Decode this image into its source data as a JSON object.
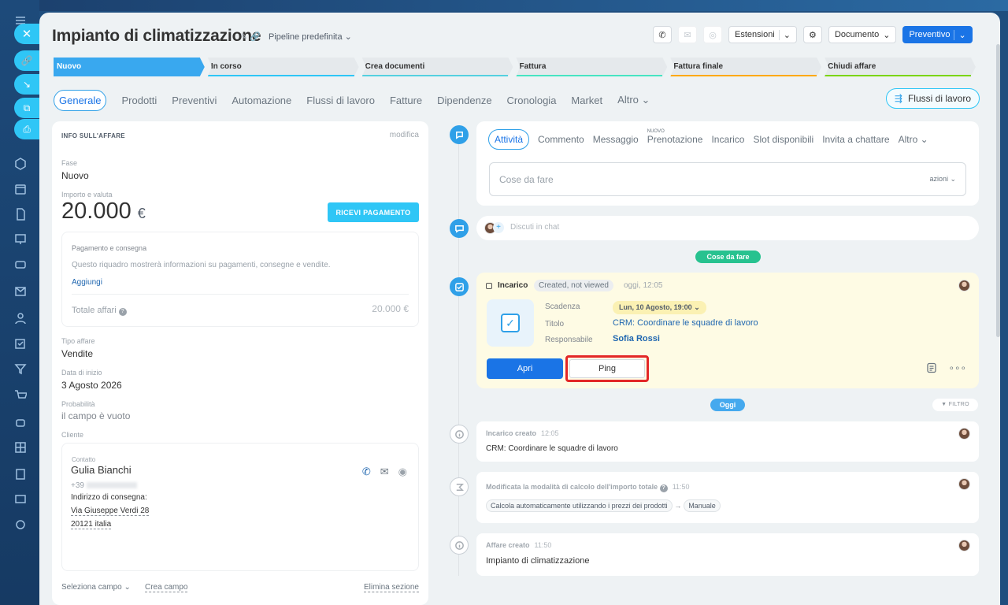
{
  "header": {
    "title": "Impianto di climatizzazione",
    "pipeline": "Pipeline predefinita",
    "estensioni": "Estensioni",
    "documento": "Documento",
    "preventivo": "Preventivo"
  },
  "stages": [
    {
      "label": "Nuovo",
      "color": "#39a8ef"
    },
    {
      "label": "In corso",
      "color": "#2fc6f6"
    },
    {
      "label": "Crea documenti",
      "color": "#55d0e0"
    },
    {
      "label": "Fattura",
      "color": "#47e4c2"
    },
    {
      "label": "Fattura finale",
      "color": "#ffa900"
    },
    {
      "label": "Chiudi affare",
      "color": "#7bd500"
    }
  ],
  "tabs": {
    "generale": "Generale",
    "prodotti": "Prodotti",
    "preventivi": "Preventivi",
    "automazione": "Automazione",
    "flussi": "Flussi di lavoro",
    "fatture": "Fatture",
    "dipendenze": "Dipendenze",
    "cronologia": "Cronologia",
    "market": "Market",
    "altro": "Altro",
    "flussi_button": "Flussi di lavoro"
  },
  "info": {
    "heading": "INFO SULL'AFFARE",
    "edit": "modifica",
    "fase_label": "Fase",
    "fase_value": "Nuovo",
    "importo_label": "Importo e valuta",
    "amount": "20.000",
    "currency": "€",
    "pay_button": "RICEVI PAGAMENTO",
    "pagamento_title": "Pagamento e consegna",
    "pagamento_text": "Questo riquadro mostrerà informazioni su pagamenti, consegne e vendite.",
    "aggiungi": "Aggiungi",
    "totale_label": "Totale affari",
    "totale_value": "20.000 €",
    "tipo_label": "Tipo affare",
    "tipo_value": "Vendite",
    "data_label": "Data di inizio",
    "data_value": "3 Agosto 2026",
    "prob_label": "Probabilità",
    "prob_value": "il campo è vuoto",
    "cliente_label": "Cliente",
    "contatto_label": "Contatto",
    "contatto_name": "Gulia Bianchi",
    "phone_prefix": "+39",
    "indirizzo_label": "Indirizzo di consegna:",
    "indirizzo_line1": "Via Giuseppe Verdi 28",
    "indirizzo_line2": "20121 italia",
    "seleziona": "Seleziona campo",
    "crea": "Crea campo",
    "elimina": "Elimina sezione"
  },
  "activity": {
    "tabs": {
      "attivita": "Attività",
      "commento": "Commento",
      "messaggio": "Messaggio",
      "nuovo_badge": "NUOVO",
      "prenotazione": "Prenotazione",
      "incarico": "Incarico",
      "slot": "Slot disponibili",
      "invita": "Invita a chattare",
      "altro": "Altro"
    },
    "todo_placeholder": "Cose da fare",
    "azioni": "azioni",
    "chat_placeholder": "Discuti in chat"
  },
  "timeline": {
    "cose_da_fare_pill": "Cose da fare",
    "oggi_pill": "Oggi",
    "filtro": "FILTRO",
    "task": {
      "title": "Incarico",
      "status": "Created, not viewed",
      "time": "oggi, 12:05",
      "scadenza_label": "Scadenza",
      "scadenza_value": "Lun, 10 Agosto, 19:00",
      "titolo_label": "Titolo",
      "titolo_value": "CRM: Coordinare le squadre di lavoro",
      "resp_label": "Responsabile",
      "resp_value": "Sofia Rossi",
      "apri": "Apri",
      "ping": "Ping"
    },
    "log1": {
      "title": "Incarico creato",
      "time": "12:05",
      "body": "CRM: Coordinare le squadre di lavoro"
    },
    "log2": {
      "title": "Modificata la modalità di calcolo dell'importo totale",
      "time": "11:50",
      "tag1": "Calcola automaticamente utilizzando i prezzi dei prodotti",
      "arrow": "→",
      "tag2": "Manuale"
    },
    "log3": {
      "title": "Affare creato",
      "time": "11:50",
      "body": "Impianto di climatizzazione"
    }
  }
}
